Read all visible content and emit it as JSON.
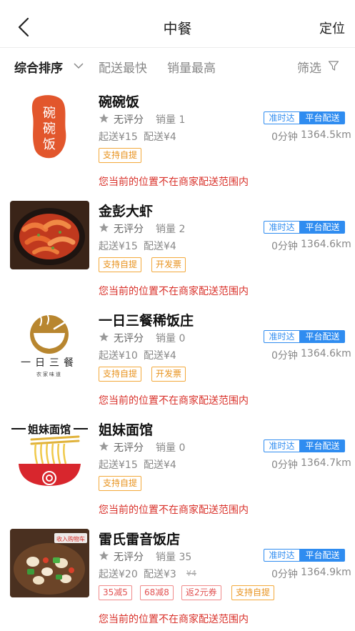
{
  "nav": {
    "title": "中餐",
    "locate": "定位"
  },
  "filters": {
    "sort": "综合排序",
    "fastest": "配送最快",
    "top_sales": "销量最高",
    "filter": "筛选"
  },
  "badges": {
    "ontime": "准时达",
    "platform": "平台配送"
  },
  "warning": "您当前的位置不在商家配送范围内",
  "colors": {
    "accent": "#2f8cf0",
    "warning": "#d9322b",
    "tag": "#e8931f",
    "promo": "#e25454"
  },
  "stores": [
    {
      "name": "碗碗饭",
      "logo_text": "碗碗饭",
      "rating": "无评分",
      "sales": "销量 1",
      "min_order": "起送¥15",
      "fee": "配送¥4",
      "time": "0分钟",
      "distance": "1364.5km",
      "tags": [
        "支持自提"
      ]
    },
    {
      "name": "金彭大虾",
      "rating": "无评分",
      "sales": "销量 2",
      "min_order": "起送¥15",
      "fee": "配送¥4",
      "time": "0分钟",
      "distance": "1364.6km",
      "tags": [
        "支持自提",
        "开发票"
      ]
    },
    {
      "name": "一日三餐稀饭庄",
      "logo_text": "一日三餐",
      "logo_sub": "农家味道",
      "rating": "无评分",
      "sales": "销量 0",
      "min_order": "起送¥10",
      "fee": "配送¥4",
      "time": "0分钟",
      "distance": "1364.6km",
      "tags": [
        "支持自提",
        "开发票"
      ]
    },
    {
      "name": "姐妹面馆",
      "logo_text": "姐妹面馆",
      "rating": "无评分",
      "sales": "销量 0",
      "min_order": "起送¥15",
      "fee": "配送¥4",
      "time": "0分钟",
      "distance": "1364.7km",
      "tags": [
        "支持自提"
      ]
    },
    {
      "name": "雷氏雷音饭店",
      "logo_text": "收入购物车",
      "rating": "无评分",
      "sales": "销量 35",
      "min_order": "起送¥20",
      "fee": "配送¥3",
      "fee_original": "¥4",
      "time": "0分钟",
      "distance": "1364.9km",
      "promos": [
        "35减5",
        "68减8",
        "返2元券"
      ],
      "tags": [
        "支持自提"
      ]
    }
  ]
}
